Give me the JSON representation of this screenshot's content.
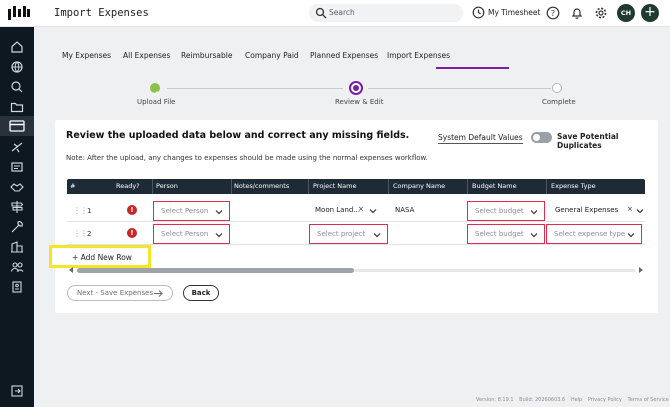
{
  "header": {
    "title": "Import Expenses",
    "search_placeholder": "Search",
    "timesheet_label": "My Timesheet",
    "avatar_initials": "CH"
  },
  "tabs": [
    {
      "label": "My Expenses"
    },
    {
      "label": "All Expenses"
    },
    {
      "label": "Reimbursable"
    },
    {
      "label": "Company Paid"
    },
    {
      "label": "Planned Expenses"
    },
    {
      "label": "Import Expenses",
      "active": true
    }
  ],
  "steps": [
    {
      "label": "Upload File",
      "state": "done"
    },
    {
      "label": "Review & Edit",
      "state": "current"
    },
    {
      "label": "Complete",
      "state": "pending"
    }
  ],
  "review": {
    "title": "Review the uploaded data below and correct any missing fields.",
    "system_defaults_link": "System Default Values",
    "toggle_label": "Save Potential Duplicates",
    "toggle_on": false,
    "note": "Note: After the upload, any changes to expenses should be made using the normal expenses workflow."
  },
  "table": {
    "columns": [
      "#",
      "Ready?",
      "Person",
      "Notes/comments",
      "Project Name",
      "Company Name",
      "Budget Name",
      "Expense Type"
    ],
    "rows": [
      {
        "num": "1",
        "ready_icon": "!",
        "person_placeholder": "Select Person",
        "notes": "",
        "project_value": "Moon Land...",
        "company": "NASA",
        "budget_placeholder": "Select budget",
        "expense_type_value": "General Expenses"
      },
      {
        "num": "2",
        "ready_icon": "!",
        "person_placeholder": "Select Person",
        "notes": "",
        "project_placeholder": "Select project",
        "company": "",
        "budget_placeholder": "Select budget",
        "expense_type_placeholder": "Select expense type"
      }
    ]
  },
  "actions": {
    "add_row": "+ Add New Row",
    "next": "Next - Save Expenses",
    "back": "Back"
  },
  "footer": {
    "version": "Version: 8.19.1",
    "build": "Build: 20260603.6",
    "help": "Help",
    "privacy": "Privacy Policy",
    "terms": "Terms of Service"
  },
  "colors": {
    "accent": "#7b1fa2",
    "success": "#8bc34a",
    "error": "#c62828",
    "sidebar": "#0e1821",
    "table_header": "#1e2a36",
    "highlight": "#f5e52a"
  }
}
